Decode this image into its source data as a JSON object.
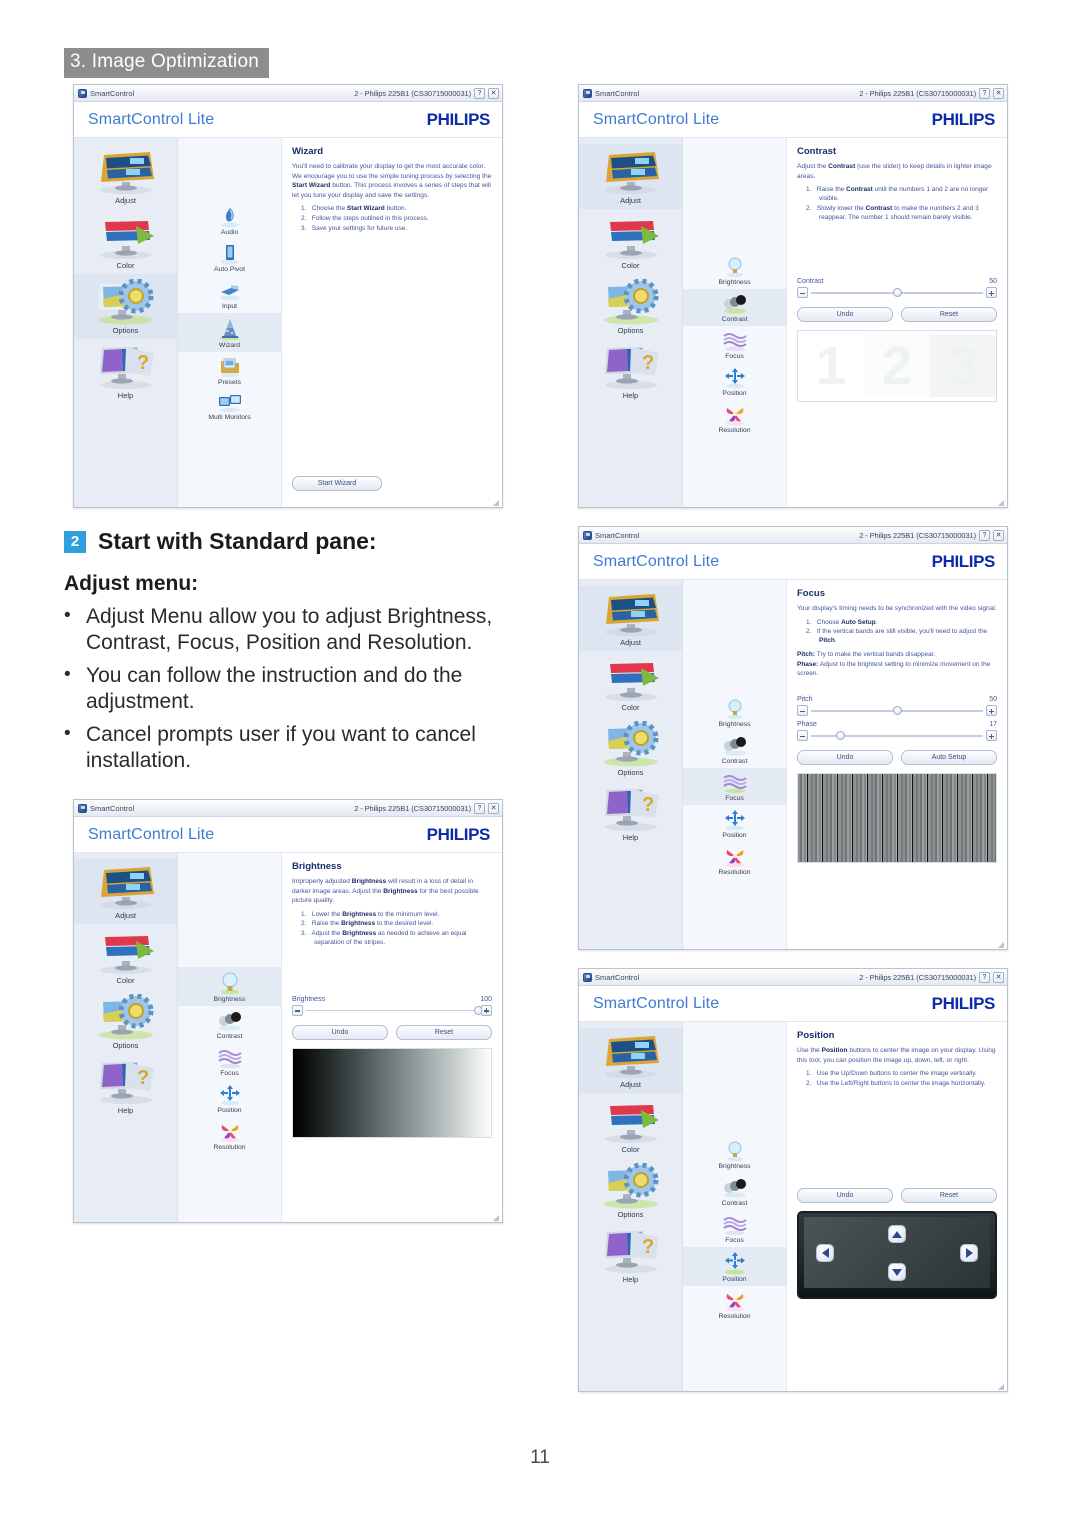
{
  "chapter": {
    "label": "3. Image Optimization"
  },
  "page_number": "11",
  "common": {
    "app_name": "SmartControl",
    "brand_left": "SmartControl Lite",
    "brand_right": "PHILIPS",
    "window_title": "2 - Philips 225B1 (CS30715000031)",
    "help_button": "?",
    "close_button": "✕",
    "main_menu": [
      {
        "label": "Adjust",
        "icon": "adjust-monitor-icon"
      },
      {
        "label": "Color",
        "icon": "color-monitor-icon"
      },
      {
        "label": "Options",
        "icon": "options-gear-icon"
      },
      {
        "label": "Help",
        "icon": "help-question-icon"
      }
    ],
    "options_submenu": [
      {
        "label": "Audio",
        "icon": "audio-icon"
      },
      {
        "label": "Auto Pivot",
        "icon": "auto-pivot-icon"
      },
      {
        "label": "Input",
        "icon": "input-plug-icon"
      },
      {
        "label": "Wizard",
        "icon": "wizard-hat-icon"
      },
      {
        "label": "Presets",
        "icon": "presets-folder-icon"
      },
      {
        "label": "Multi Monitors",
        "icon": "multi-monitors-icon"
      }
    ],
    "adjust_submenu": [
      {
        "label": "Brightness",
        "icon": "brightness-bulb-icon"
      },
      {
        "label": "Contrast",
        "icon": "contrast-spheres-icon"
      },
      {
        "label": "Focus",
        "icon": "focus-waves-icon"
      },
      {
        "label": "Position",
        "icon": "position-arrows-icon"
      },
      {
        "label": "Resolution",
        "icon": "resolution-pinwheel-icon"
      }
    ],
    "buttons": {
      "undo": "Undo",
      "reset": "Reset",
      "auto_setup": "Auto Setup",
      "start_wizard": "Start Wizard"
    }
  },
  "windows": {
    "wizard": {
      "active_main": "Options",
      "active_sub": "Wizard",
      "panel_title": "Wizard",
      "intro": "You'll need to calibrate your display to get the most accurate color. We encourage you to use the simple tuning process by selecting the Start Wizard button. This process involves a series of steps that will let you tune your display and save the settings.",
      "steps": [
        "Choose the Start Wizard button.",
        "Follow the steps outlined in this process.",
        "Save your settings for future use."
      ]
    },
    "contrast": {
      "active_main": "Adjust",
      "active_sub": "Contrast",
      "panel_title": "Contrast",
      "intro": "Adjust the Contrast (use the slider) to keep details in lighter image areas.",
      "steps": [
        "Raise the Contrast until the numbers 1 and 2 are no longer visible.",
        "Slowly lower the Contrast to make the numbers 2 and 3 reappear. The number 1 should remain barely visible."
      ],
      "slider": {
        "label": "Contrast",
        "value": "50",
        "percent": 50
      },
      "preview_digits": [
        "1",
        "2",
        "3"
      ]
    },
    "brightness": {
      "active_main": "Adjust",
      "active_sub": "Brightness",
      "panel_title": "Brightness",
      "intro": "Improperly adjusted Brightness will result in a loss of detail in darker image areas. Adjust the Brightness for the best possible picture quality.",
      "steps": [
        "Lower the Brightness to the minimum level.",
        "Raise the Brightness to the desired level.",
        "Adjust the Brightness as needed to achieve an equal separation of the stripes."
      ],
      "slider": {
        "label": "Brightness",
        "value": "100",
        "percent": 100
      }
    },
    "focus": {
      "active_main": "Adjust",
      "active_sub": "Focus",
      "panel_title": "Focus",
      "intro": "Your display's timing needs to be synchronized with the video signal.",
      "steps": [
        "Choose Auto Setup.",
        "If the vertical bands are still visible, you'll need to adjust the Pitch."
      ],
      "note_pitch": "Pitch: Try to make the vertical bands disappear.",
      "note_phase": "Phase: Adjust to the brightest setting to minimize movement on the screen.",
      "slider_pitch": {
        "label": "Pitch",
        "value": "50",
        "percent": 50
      },
      "slider_phase": {
        "label": "Phase",
        "value": "17",
        "percent": 17
      }
    },
    "position": {
      "active_main": "Adjust",
      "active_sub": "Position",
      "panel_title": "Position",
      "intro": "Use the Position buttons to center the image on your display. Using this tool, you can position the image up, down, left, or right.",
      "steps": [
        "Use the Up/Down buttons to center the image vertically.",
        "Use the Left/Right buttons to center the image horizontally."
      ],
      "dpad": {
        "up": "up-arrow-button",
        "down": "down-arrow-button",
        "left": "left-arrow-button",
        "right": "right-arrow-button"
      }
    }
  },
  "body_copy": {
    "step_number": "2",
    "step_title": "Start with Standard pane:",
    "subheading": "Adjust menu:",
    "bullets": [
      "Adjust Menu allow you to adjust Brightness, Contrast, Focus, Position and Resolution.",
      "You can follow the instruction and do the adjustment.",
      "Cancel prompts user if you want to cancel installation."
    ]
  },
  "colors": {
    "accent_blue": "#2f9fe0",
    "brand_blue": "#0b2bab",
    "link_blue": "#3f7bd4",
    "panel_text": "#42549b",
    "chapter_gray": "#8d8d8d"
  }
}
